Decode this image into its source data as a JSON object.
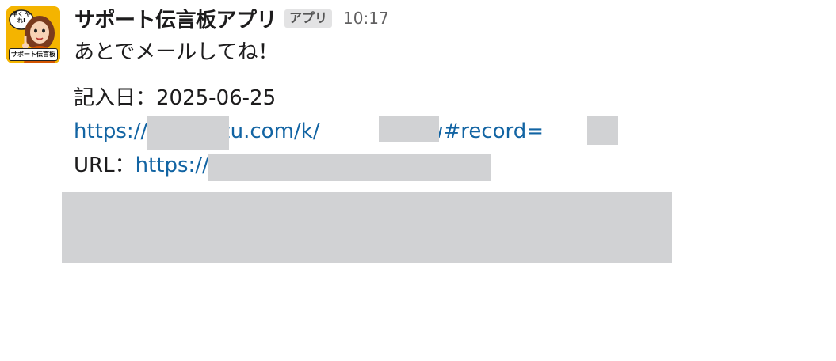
{
  "message": {
    "sender_name": "サポート伝言板アプリ",
    "app_badge": "アプリ",
    "timestamp": "10:17",
    "avatar": {
      "speech_bubble": "早く やれ!",
      "label": "サポート伝言板",
      "background_color": "#f4b400"
    },
    "body_text": "あとでメールしてね！",
    "entry_date_label": "記入日：",
    "entry_date_value": "2025-06-25",
    "record_link": {
      "part1": "https://r",
      "part2": "cybozu.com/k/",
      "part3": "/show#record="
    },
    "url_label": "URL：",
    "url_link": "https://"
  },
  "colors": {
    "link": "#1264a3",
    "text": "#1d1c1d",
    "timestamp": "#616061",
    "redaction": "#d1d2d4"
  }
}
